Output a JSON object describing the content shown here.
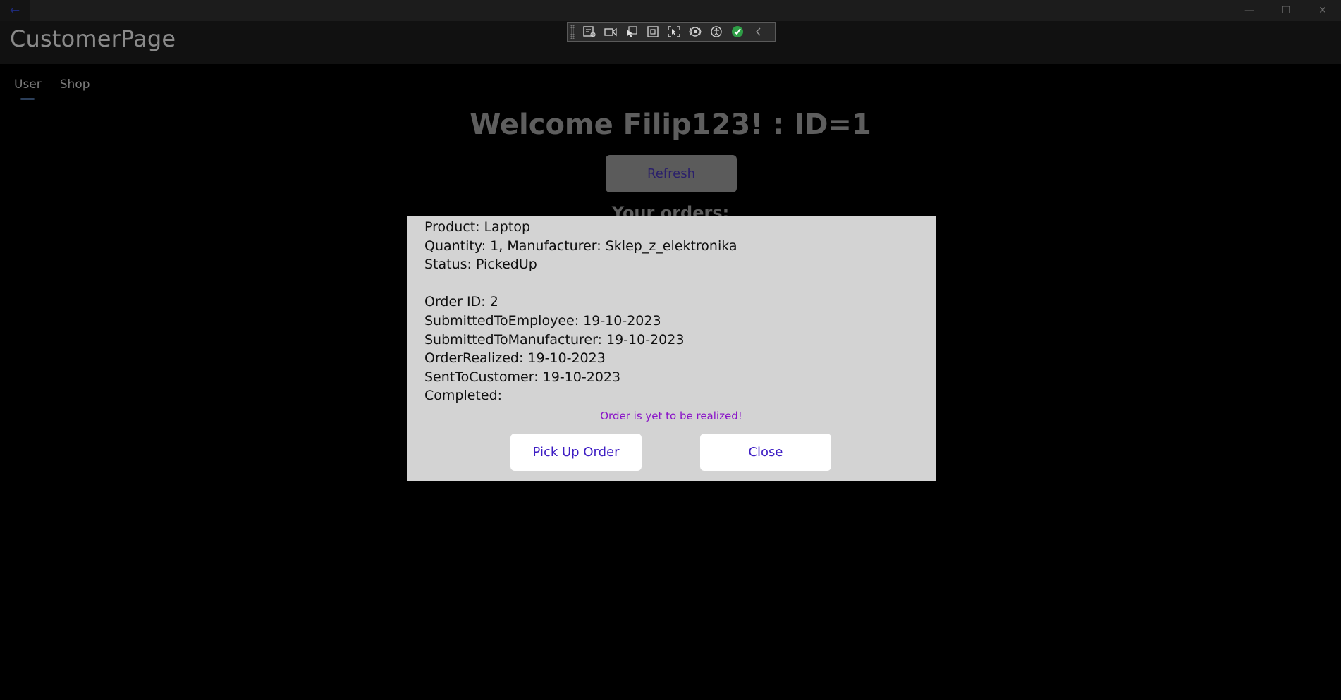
{
  "window": {
    "back_icon": "arrow-left-icon",
    "controls": [
      {
        "name": "minimize-button",
        "glyph": "—"
      },
      {
        "name": "maximize-button",
        "glyph": "☐"
      },
      {
        "name": "close-window-button",
        "glyph": "✕"
      }
    ]
  },
  "header": {
    "title": "CustomerPage"
  },
  "debug_toolbar": {
    "tools": [
      "live-visual-tree-icon",
      "select-element-icon",
      "display-adorners-icon",
      "track-focus-icon",
      "binding-failures-icon",
      "accessibility-icon",
      "checked-status-icon",
      "collapse-chevron-icon"
    ]
  },
  "tabs": [
    {
      "label": "User",
      "selected": true
    },
    {
      "label": "Shop",
      "selected": false
    }
  ],
  "main": {
    "welcome": "Welcome Filip123! : ID=1",
    "refresh_label": "Refresh",
    "orders_heading": "Your orders:"
  },
  "popup": {
    "lines": [
      "Product: Laptop",
      "Quantity: 1, Manufacturer: Sklep_z_elektronika",
      "Status: PickedUp",
      "",
      "Order ID: 2",
      "SubmittedToEmployee: 19-10-2023",
      "SubmittedToManufacturer: 19-10-2023",
      "OrderRealized: 19-10-2023",
      "SentToCustomer: 19-10-2023",
      "Completed:"
    ],
    "notice": "Order is yet to be realized!",
    "pickup_label": "Pick Up Order",
    "close_label": "Close"
  },
  "colors": {
    "background": "#000000",
    "popup_background": "#d3d3d3",
    "notice_text": "#8a13c8",
    "button_text": "#3f1fc4"
  }
}
